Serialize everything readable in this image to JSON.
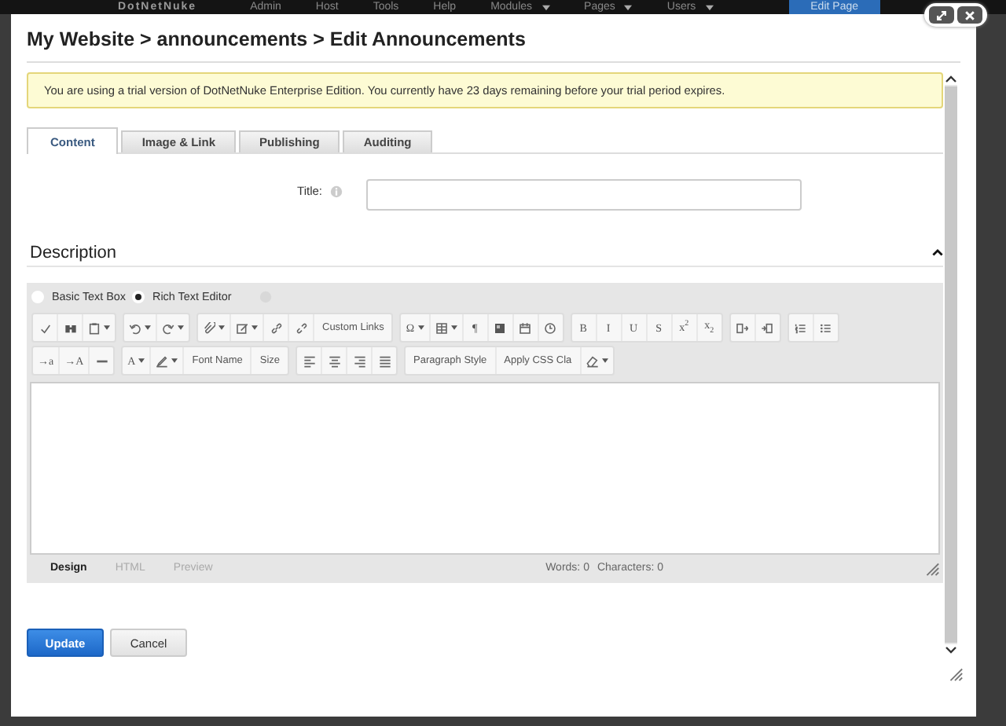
{
  "top_bar": {
    "logo": "DotNetNuke",
    "menu": [
      {
        "label": "Admin",
        "dropdown": false
      },
      {
        "label": "Host",
        "dropdown": false
      },
      {
        "label": "Tools",
        "dropdown": false
      },
      {
        "label": "Help",
        "dropdown": false
      },
      {
        "label": "Modules",
        "dropdown": true
      },
      {
        "label": "Pages",
        "dropdown": true
      },
      {
        "label": "Users",
        "dropdown": true
      }
    ],
    "edit_button": "Edit Page"
  },
  "dialog": {
    "title": "My Website > announcements > Edit Announcements",
    "notice": "You are using a trial version of DotNetNuke Enterprise Edition. You currently have 23 days remaining before your trial period expires.",
    "tabs": [
      {
        "label": "Content",
        "selected": true
      },
      {
        "label": "Image & Link",
        "selected": false
      },
      {
        "label": "Publishing",
        "selected": false
      },
      {
        "label": "Auditing",
        "selected": false
      }
    ],
    "title_field": {
      "label": "Title:"
    },
    "section": {
      "heading": "Description",
      "expanded": true
    },
    "editor_mode": [
      {
        "label": "Basic Text Box",
        "selected": false
      },
      {
        "label": "Rich Text Editor",
        "selected": true
      }
    ],
    "toolbar": [
      [
        {
          "items": [
            {
              "kind": "icon",
              "dropdown": false
            },
            {
              "kind": "icon",
              "dropdown": false
            },
            {
              "kind": "icon",
              "dropdown": true
            }
          ]
        },
        {
          "items": [
            {
              "kind": "icon",
              "dropdown": true
            },
            {
              "kind": "icon",
              "dropdown": true
            }
          ]
        },
        {
          "items": [
            {
              "kind": "icon",
              "dropdown": true
            },
            {
              "kind": "icon",
              "dropdown": true
            },
            {
              "kind": "icon",
              "dropdown": false
            },
            {
              "kind": "icon",
              "dropdown": false
            },
            {
              "kind": "text",
              "label": "Custom Links",
              "dropdown": false
            }
          ]
        },
        {
          "items": [
            {
              "kind": "glyph",
              "label": "Ω",
              "dropdown": true
            },
            {
              "kind": "icon",
              "dropdown": true
            },
            {
              "kind": "glyph",
              "label": "¶",
              "dropdown": false
            },
            {
              "kind": "icon",
              "dropdown": false
            },
            {
              "kind": "icon",
              "dropdown": false
            },
            {
              "kind": "icon",
              "dropdown": false
            }
          ]
        },
        {
          "items": [
            {
              "kind": "glyph",
              "label": "B",
              "dropdown": false
            },
            {
              "kind": "glyph",
              "label": "I",
              "dropdown": false
            },
            {
              "kind": "glyph",
              "label": "U",
              "dropdown": false
            },
            {
              "kind": "glyph",
              "label": "S",
              "dropdown": false
            },
            {
              "kind": "glyph",
              "label": "x$^{2}$",
              "dropdown": false
            },
            {
              "kind": "glyph",
              "label": "x$_{2}$",
              "dropdown": false
            }
          ]
        },
        {
          "items": [
            {
              "kind": "icon",
              "dropdown": false
            },
            {
              "kind": "icon",
              "dropdown": false
            }
          ]
        },
        {
          "items": [
            {
              "kind": "icon",
              "dropdown": false
            },
            {
              "kind": "icon",
              "dropdown": false
            }
          ]
        }
      ],
      [
        {
          "items": [
            {
              "kind": "glyph",
              "label": "→a",
              "dropdown": false
            },
            {
              "kind": "glyph",
              "label": "→A",
              "dropdown": false
            },
            {
              "kind": "icon",
              "dropdown": false
            }
          ]
        },
        {
          "items": [
            {
              "kind": "glyph",
              "label": "A",
              "dropdown": true
            },
            {
              "kind": "icon",
              "dropdown": true
            },
            {
              "kind": "text",
              "label": "Font Name",
              "dropdown": false
            },
            {
              "kind": "text",
              "label": "Size",
              "dropdown": false
            }
          ]
        },
        {
          "items": [
            {
              "kind": "icon",
              "dropdown": false
            },
            {
              "kind": "icon",
              "dropdown": false
            },
            {
              "kind": "icon",
              "dropdown": false
            },
            {
              "kind": "icon",
              "dropdown": false
            }
          ]
        },
        {
          "items": [
            {
              "kind": "text",
              "label": "Paragraph Style",
              "dropdown": false
            },
            {
              "kind": "text",
              "label": "Apply CSS Cla",
              "dropdown": false
            },
            {
              "kind": "icon",
              "dropdown": true
            }
          ]
        }
      ]
    ],
    "view_tabs": [
      {
        "label": "Design",
        "selected": true
      },
      {
        "label": "HTML",
        "selected": false
      },
      {
        "label": "Preview",
        "selected": false
      }
    ],
    "counts": [
      "Words: 0",
      "Characters: 0"
    ],
    "buttons": [
      {
        "label": "Update",
        "kind": "primary"
      },
      {
        "label": "Cancel",
        "kind": "secondary"
      }
    ]
  }
}
